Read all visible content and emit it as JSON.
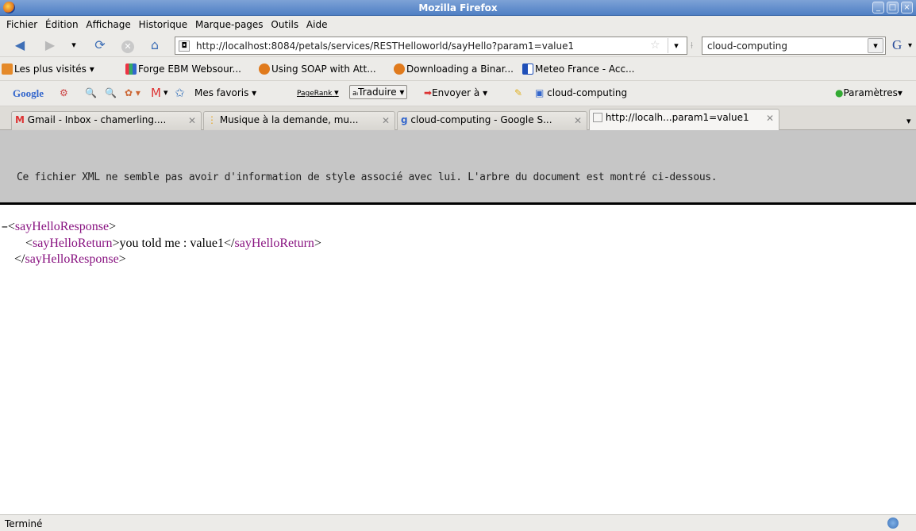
{
  "window": {
    "title": "Mozilla Firefox"
  },
  "menu": [
    "Fichier",
    "Édition",
    "Affichage",
    "Historique",
    "Marque-pages",
    "Outils",
    "Aide"
  ],
  "nav": {
    "url": "http://localhost:8084/petals/services/RESTHelloworld/sayHello?param1=value1",
    "search_value": "cloud-computing",
    "search_engine_glyph": "G"
  },
  "bookmarks": [
    "Les plus visités",
    "Forge EBM Websour...",
    "Using SOAP with Att...",
    "Downloading a Binar...",
    "Meteo France - Acc..."
  ],
  "google_toolbar": {
    "logo": "Google",
    "mes_favoris": "Mes favoris",
    "pagerank": "PageRank",
    "traduire": "Traduire",
    "envoyer": "Envoyer à",
    "search_term": "cloud-computing",
    "parametres": "Paramètres"
  },
  "tabs": [
    "Gmail - Inbox - chamerling....",
    "Musique à la demande, mu...",
    "cloud-computing - Google S...",
    "http://localh...param1=value1"
  ],
  "content": {
    "xml_notice": "Ce fichier XML ne semble pas avoir d'information de style associé avec lui. L'arbre du document est montré ci-dessous.",
    "root_tag": "sayHelloResponse",
    "child_tag": "sayHelloReturn",
    "child_text": "you told me : value1"
  },
  "status": {
    "text": "Terminé"
  }
}
